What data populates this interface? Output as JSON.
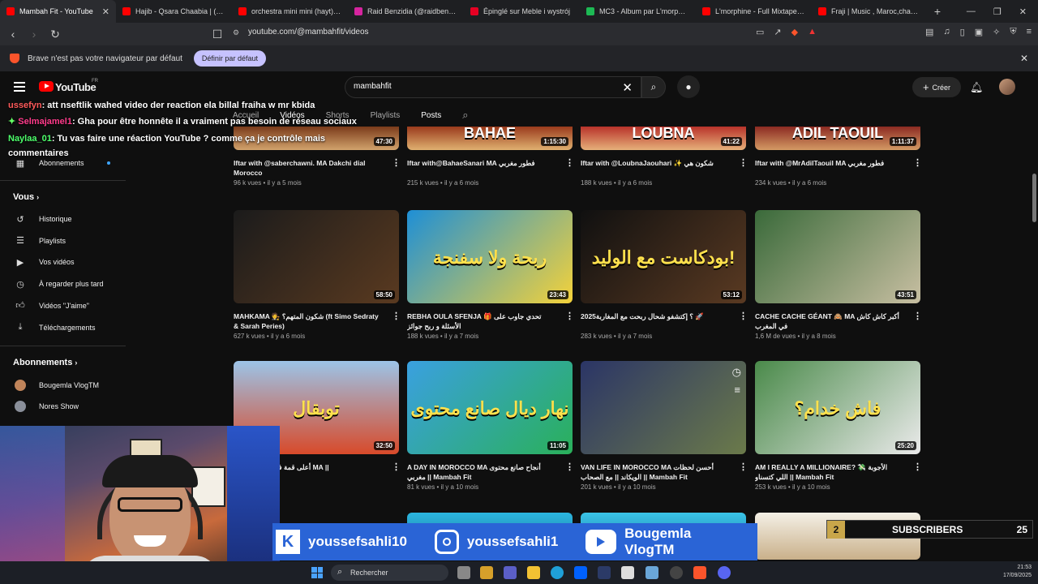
{
  "browser": {
    "tabs": [
      {
        "title": "Mambah Fit - YouTube",
        "active": true,
        "color": "#ff0000"
      },
      {
        "title": "Hajib - Qsara Chaabia | (حصري)",
        "color": "#ff0000"
      },
      {
        "title": "orchestra mini mini (hayt) - You",
        "color": "#ff0000"
      },
      {
        "title": "Raid Benzidia (@raidbenzidia)",
        "color": "#d6249f"
      },
      {
        "title": "Épinglé sur Meble i wystrój",
        "color": "#e60023"
      },
      {
        "title": "MC3 - Album par L'morphine |",
        "color": "#1db954"
      },
      {
        "title": "L'morphine - Full Mixtape MC",
        "color": "#ff0000"
      },
      {
        "title": "Fraji | Music , Maroc,chaabi,m",
        "color": "#ff0000"
      }
    ],
    "url": "youtube.com/@mambahfit/videos",
    "infobar": {
      "message": "Brave n'est pas votre navigateur par défaut",
      "button": "Définir par défaut"
    }
  },
  "youtube": {
    "logo_text": "YouTube",
    "region": "FR",
    "search": {
      "value": "mambahfit"
    },
    "create_label": "Créer",
    "channel_tabs": [
      "Accueil",
      "Vidéos",
      "Shorts",
      "Playlists",
      "Posts"
    ]
  },
  "sidebar": {
    "subscriptions_item": "Abonnements",
    "vous_heading": "Vous",
    "vous_items": [
      {
        "label": "Historique",
        "icon": "history-icon"
      },
      {
        "label": "Playlists",
        "icon": "playlist-icon"
      },
      {
        "label": "Vos vidéos",
        "icon": "video-icon"
      },
      {
        "label": "À regarder plus tard",
        "icon": "clock-icon"
      },
      {
        "label": "Vidéos \"J'aime\"",
        "icon": "thumbs-up-icon"
      },
      {
        "label": "Téléchargements",
        "icon": "download-icon"
      }
    ],
    "abonnements_heading": "Abonnements",
    "subscriptions": [
      {
        "name": "Bougemla VlogTM"
      },
      {
        "name": "Nores Show"
      }
    ]
  },
  "videos": [
    {
      "title": "Iftar with @saberchawni. MA Dakchi dial Morocco",
      "views": "96 k vues",
      "age": "il y a 5 mois",
      "duration": "47:30"
    },
    {
      "title": "Iftar with@BahaeSanari MA فطور مغربي",
      "views": "215 k vues",
      "age": "il y a 6 mois",
      "duration": "1:15:30",
      "thumb_text": "BAHAE"
    },
    {
      "title": "Iftar with @LoubnaJaouhari ✨ شكون هي",
      "views": "188 k vues",
      "age": "il y a 6 mois",
      "duration": "41:22",
      "thumb_text": "LOUBNA"
    },
    {
      "title": "Iftar with @MrAdilTaouil MA فطور مغربي",
      "views": "234 k vues",
      "age": "il y a 6 mois",
      "duration": "1:11:37",
      "thumb_text": "ADIL TAOUIL"
    },
    {
      "title": "MAHKAMA 🧑‍⚖️ شكون المتهم؟ (ft Simo Sedraty & Sarah Peries)",
      "views": "627 k vues",
      "age": "il y a 6 mois",
      "duration": "58:50"
    },
    {
      "title": "REBHA OULA SFENJA 🎁 تحدي جاوب على الأسئلة و ربح جوائز",
      "views": "188 k vues",
      "age": "il y a 7 mois",
      "duration": "23:43",
      "thumb_text": "ربحة ولا سفنجة"
    },
    {
      "title": "2025؟ إكتشفو شحال ربحت مع المغاربة 🚀",
      "views": "283 k vues",
      "age": "il y a 7 mois",
      "duration": "53:12",
      "thumb_text": "بودكاست مع الوليد!"
    },
    {
      "title": "CACHE CACHE GÉANT 🙈 MA أكبر كاش كاش في المغرب",
      "views": "1,6 M de vues",
      "age": "il y a 8 mois",
      "duration": "43:51"
    },
    {
      "title": "أعلى قمة في شمال إفريقيا MA ||",
      "views": "",
      "age": "il y a 10 mois",
      "duration": "32:50",
      "thumb_text": "توبقال"
    },
    {
      "title": "A DAY IN MOROCCO MA أنجاح صانع محتوى مغربي || Mambah Fit",
      "views": "81 k vues",
      "age": "il y a 10 mois",
      "duration": "11:05",
      "thumb_text": "نهار ديال صانع محتوى"
    },
    {
      "title": "VAN LIFE IN MOROCCO MA أحسن لحظات الويكاند || مع الصحاب || Mambah Fit",
      "views": "201 k vues",
      "age": "il y a 10 mois",
      "duration": ""
    },
    {
      "title": "AM I REALLY A MILLIONAIRE? 💸 الأجوبة اللي كتسناو || Mambah Fit",
      "views": "253 k vues",
      "age": "il y a 10 mois",
      "duration": "25:20",
      "thumb_text": "فاش خدام؟"
    }
  ],
  "chat": [
    {
      "user": "ussefyn",
      "text": ": att nseftlik wahed video der reaction ela billal fraiha w mr kbida",
      "color": "#ff5a5a"
    },
    {
      "user": "Selmajamel1",
      "text": ": Gha pour être honnête il a vraiment pas besoin de réseau sociaux",
      "color": "#ff3b8b"
    },
    {
      "user": "Naylaa_01",
      "text": ": Tu vas faire une réaction YouTube ? comme ça je contrôle mais commentaires",
      "color": "#4dff6b"
    }
  ],
  "overlay": {
    "socials": [
      {
        "handle": "youssefsahli10",
        "icon": "kick-icon"
      },
      {
        "handle": "youssefsahli1",
        "icon": "instagram-icon"
      },
      {
        "handle": "Bougemla VlogTM",
        "icon": "youtube-icon"
      }
    ],
    "subs_badge": "2",
    "subs_label": "SUBSCRIBERS",
    "subs_count": "25"
  },
  "taskbar": {
    "search_placeholder": "Rechercher",
    "time": "21:53",
    "date": "17/09/2025"
  }
}
